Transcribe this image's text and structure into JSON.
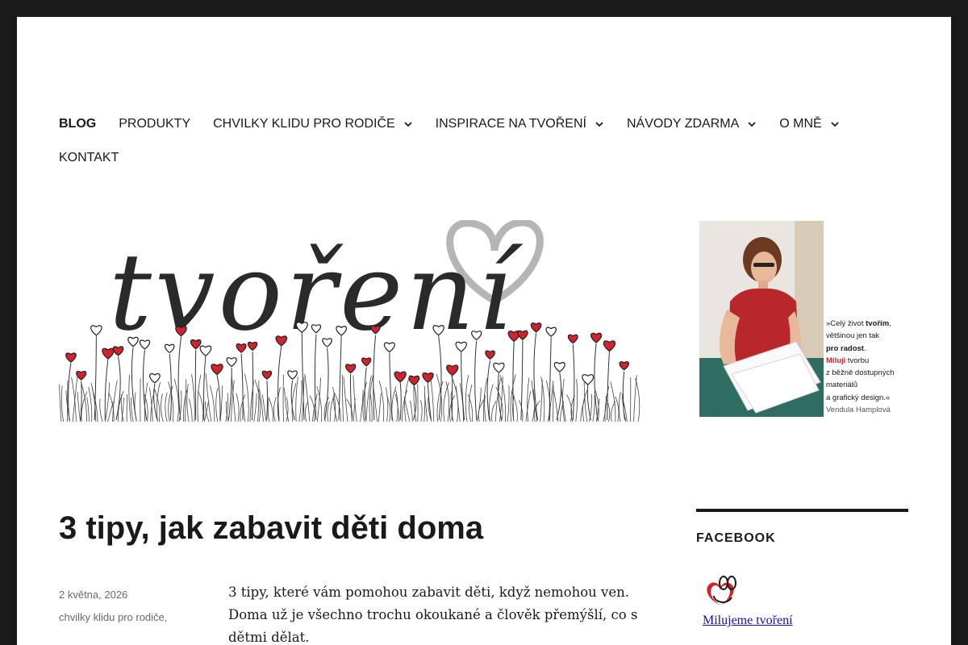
{
  "nav": {
    "items": [
      {
        "label": "BLOG",
        "active": true,
        "has_submenu": false
      },
      {
        "label": "PRODUKTY",
        "active": false,
        "has_submenu": false
      },
      {
        "label": "CHVILKY KLIDU PRO RODIČE",
        "active": false,
        "has_submenu": true
      },
      {
        "label": "INSPIRACE NA TVOŘENÍ",
        "active": false,
        "has_submenu": true
      },
      {
        "label": "NÁVODY ZDARMA",
        "active": false,
        "has_submenu": true
      },
      {
        "label": "O MNĚ",
        "active": false,
        "has_submenu": true
      },
      {
        "label": "KONTAKT",
        "active": false,
        "has_submenu": false
      }
    ]
  },
  "header": {
    "logo_text": "tvoření"
  },
  "banner": {
    "quote_line1_pre": "»Celý život ",
    "quote_line1_bold": "tvořím",
    "quote_line1_post": ",",
    "quote_line2": "většinou jen tak",
    "quote_line3": "pro radost",
    "quote_line3_post": ".",
    "quote_line4_red": "Miluji",
    "quote_line4_post": " tvorbu",
    "quote_line5": "z běžně dostupných",
    "quote_line6": "materiálů",
    "quote_line7": "a grafický design.«",
    "author": "Vendula Hamplová"
  },
  "article": {
    "title": "3 tipy, jak zabavit děti doma",
    "date": "2 května, 2026",
    "category": "chvilky klidu pro rodiče",
    "category_sep": ",",
    "excerpt": "3 tipy, které vám pomohou zabavit děti, když nemohou ven. Doma už je všechno trochu okoukané a člověk přemýšlí, co s dětmi dělat."
  },
  "sidebar": {
    "widget_title": "FACEBOOK",
    "fb_link_text": "Milujeme tvoření"
  },
  "colors": {
    "accent_red": "#d0232e",
    "text": "#1a1a1a",
    "frame": "#1a1a1a",
    "link": "#1a0dab"
  }
}
